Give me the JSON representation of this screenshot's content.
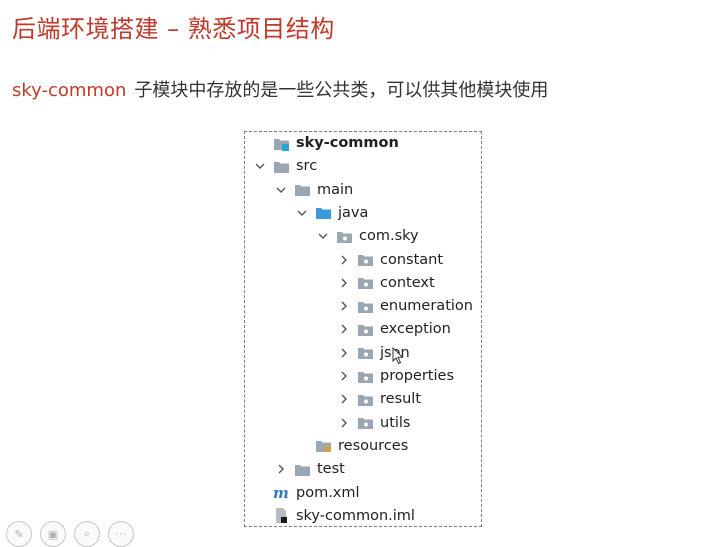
{
  "slide": {
    "title": "后端环境搭建 – 熟悉项目结构",
    "subtitle_highlight": "sky-common",
    "subtitle_rest": "子模块中存放的是一些公共类，可以供其他模块使用"
  },
  "tree": [
    {
      "label": "sky-common",
      "depth": 0,
      "chevron": "none",
      "icon": "module-folder-icon",
      "bold": true
    },
    {
      "label": "src",
      "depth": 0,
      "chevron": "down",
      "icon": "folder-icon"
    },
    {
      "label": "main",
      "depth": 1,
      "chevron": "down",
      "icon": "folder-icon"
    },
    {
      "label": "java",
      "depth": 2,
      "chevron": "down",
      "icon": "source-folder-icon"
    },
    {
      "label": "com.sky",
      "depth": 3,
      "chevron": "down",
      "icon": "package-icon"
    },
    {
      "label": "constant",
      "depth": 4,
      "chevron": "right",
      "icon": "package-icon"
    },
    {
      "label": "context",
      "depth": 4,
      "chevron": "right",
      "icon": "package-icon"
    },
    {
      "label": "enumeration",
      "depth": 4,
      "chevron": "right",
      "icon": "package-icon"
    },
    {
      "label": "exception",
      "depth": 4,
      "chevron": "right",
      "icon": "package-icon"
    },
    {
      "label": "json",
      "depth": 4,
      "chevron": "right",
      "icon": "package-icon"
    },
    {
      "label": "properties",
      "depth": 4,
      "chevron": "right",
      "icon": "package-icon"
    },
    {
      "label": "result",
      "depth": 4,
      "chevron": "right",
      "icon": "package-icon"
    },
    {
      "label": "utils",
      "depth": 4,
      "chevron": "right",
      "icon": "package-icon"
    },
    {
      "label": "resources",
      "depth": 2,
      "chevron": "none",
      "icon": "resources-folder-icon"
    },
    {
      "label": "test",
      "depth": 1,
      "chevron": "right",
      "icon": "folder-icon"
    },
    {
      "label": "pom.xml",
      "depth": 0,
      "chevron": "none",
      "icon": "maven-icon"
    },
    {
      "label": "sky-common.iml",
      "depth": 0,
      "chevron": "none",
      "icon": "iml-file-icon"
    }
  ],
  "toolbar": [
    {
      "icon": "pen-icon",
      "glyph": "✎"
    },
    {
      "icon": "slide-sorter-icon",
      "glyph": "▣"
    },
    {
      "icon": "zoom-icon",
      "glyph": "⌕"
    },
    {
      "icon": "more-icon",
      "glyph": "···"
    }
  ],
  "colors": {
    "title": "#c0392b",
    "folder": "#9aa7b3",
    "source_folder": "#3d9ad8",
    "maven": "#2f7bbf"
  }
}
